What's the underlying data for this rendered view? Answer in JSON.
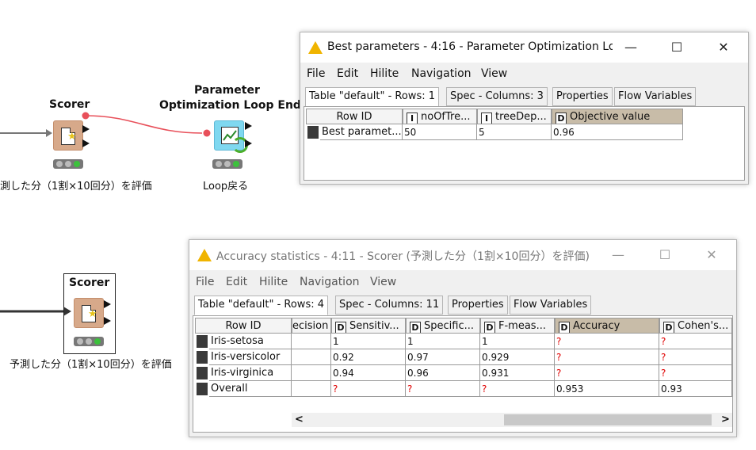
{
  "nodes": {
    "scorer1": {
      "title": "Scorer",
      "subtitle": "測した分（1割×10回分）を評価"
    },
    "loop_end": {
      "title_line1": "Parameter",
      "title_line2": "Optimization Loop End",
      "subtitle": "Loop戻る"
    },
    "scorer2": {
      "title": "Scorer",
      "subtitle": "予測した分（1割×10回分）を評価"
    }
  },
  "best_params_window": {
    "title": "Best parameters - 4:16 - Parameter Optimization Lo...",
    "controls": {
      "minimize": "—",
      "maximize": "☐",
      "close": "✕"
    },
    "menu": [
      "File",
      "Edit",
      "Hilite",
      "Navigation",
      "View"
    ],
    "tabs": [
      "Table \"default\" - Rows: 1",
      "Spec - Columns: 3",
      "Properties",
      "Flow Variables"
    ],
    "columns": [
      {
        "label": "Row ID",
        "type": ""
      },
      {
        "label": "noOfTre...",
        "type": "I"
      },
      {
        "label": "treeDep...",
        "type": "I"
      },
      {
        "label": "Objective value",
        "type": "D"
      }
    ],
    "rows": [
      [
        "Best paramet...",
        "50",
        "5",
        "0.96"
      ]
    ]
  },
  "accuracy_window": {
    "title": "Accuracy statistics - 4:11 - Scorer (予測した分（1割×10回分）を評価)",
    "controls": {
      "minimize": "—",
      "maximize": "☐",
      "close": "✕"
    },
    "menu": [
      "File",
      "Edit",
      "Hilite",
      "Navigation",
      "View"
    ],
    "tabs": [
      "Table \"default\" - Rows: 4",
      "Spec - Columns: 11",
      "Properties",
      "Flow Variables"
    ],
    "columns": [
      {
        "label": "Row ID",
        "type": ""
      },
      {
        "label": "ecision",
        "type": ""
      },
      {
        "label": "Sensitiv...",
        "type": "D"
      },
      {
        "label": "Specific...",
        "type": "D"
      },
      {
        "label": "F-meas...",
        "type": "D"
      },
      {
        "label": "Accuracy",
        "type": "D"
      },
      {
        "label": "Cohen's...",
        "type": "D"
      }
    ],
    "rows": [
      [
        "Iris-setosa",
        "",
        "1",
        "1",
        "1",
        "?",
        "?"
      ],
      [
        "Iris-versicolor",
        "",
        "0.92",
        "0.97",
        "0.929",
        "?",
        "?"
      ],
      [
        "Iris-virginica",
        "",
        "0.94",
        "0.96",
        "0.931",
        "?",
        "?"
      ],
      [
        "Overall",
        "",
        "?",
        "?",
        "?",
        "0.953",
        "0.93"
      ]
    ],
    "scroll_left": "<",
    "scroll_right": ">"
  },
  "colors": {
    "warning": "#f0b400",
    "selected_header": "#c8bca8",
    "missing_value": "#e00000",
    "scorer_node": "#d7a98a",
    "loop_node": "#7fd8f0",
    "connection_active": "#e8505a"
  }
}
